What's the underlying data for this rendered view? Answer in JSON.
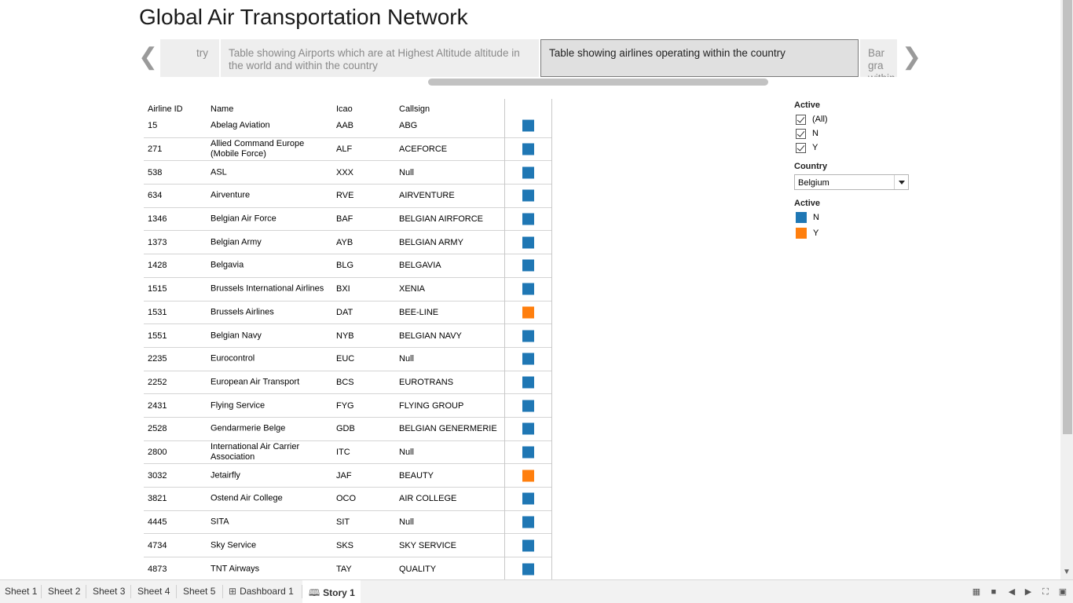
{
  "story": {
    "title": "Global Air Transportation Network"
  },
  "navigator": {
    "points": [
      "try",
      "Table showing Airports which are at Highest Altitude altitude in the world and within the country",
      "Table showing airlines operating within the country",
      "Bar gra within"
    ],
    "active_index": 2
  },
  "table": {
    "headers": [
      "Airline ID",
      "Name",
      "Icao",
      "Callsign"
    ],
    "rows": [
      {
        "id": "15",
        "name": "Abelag Aviation",
        "icao": "AAB",
        "callsign": "ABG",
        "active": "N"
      },
      {
        "id": "271",
        "name": "Allied Command Europe (Mobile Force)",
        "icao": "ALF",
        "callsign": "ACEFORCE",
        "active": "N"
      },
      {
        "id": "538",
        "name": "ASL",
        "icao": "XXX",
        "callsign": "Null",
        "active": "N"
      },
      {
        "id": "634",
        "name": "Airventure",
        "icao": "RVE",
        "callsign": "AIRVENTURE",
        "active": "N"
      },
      {
        "id": "1346",
        "name": "Belgian Air Force",
        "icao": "BAF",
        "callsign": "BELGIAN AIRFORCE",
        "active": "N"
      },
      {
        "id": "1373",
        "name": "Belgian Army",
        "icao": "AYB",
        "callsign": "BELGIAN ARMY",
        "active": "N"
      },
      {
        "id": "1428",
        "name": "Belgavia",
        "icao": "BLG",
        "callsign": "BELGAVIA",
        "active": "N"
      },
      {
        "id": "1515",
        "name": "Brussels International Airlines",
        "icao": "BXI",
        "callsign": "XENIA",
        "active": "N"
      },
      {
        "id": "1531",
        "name": "Brussels Airlines",
        "icao": "DAT",
        "callsign": "BEE-LINE",
        "active": "Y"
      },
      {
        "id": "1551",
        "name": "Belgian Navy",
        "icao": "NYB",
        "callsign": "BELGIAN NAVY",
        "active": "N"
      },
      {
        "id": "2235",
        "name": "Eurocontrol",
        "icao": "EUC",
        "callsign": "Null",
        "active": "N"
      },
      {
        "id": "2252",
        "name": "European Air Transport",
        "icao": "BCS",
        "callsign": "EUROTRANS",
        "active": "N"
      },
      {
        "id": "2431",
        "name": "Flying Service",
        "icao": "FYG",
        "callsign": "FLYING GROUP",
        "active": "N"
      },
      {
        "id": "2528",
        "name": "Gendarmerie Belge",
        "icao": "GDB",
        "callsign": "BELGIAN GENERMERIE",
        "active": "N"
      },
      {
        "id": "2800",
        "name": "International Air Carrier Association",
        "icao": "ITC",
        "callsign": "Null",
        "active": "N"
      },
      {
        "id": "3032",
        "name": "Jetairfly",
        "icao": "JAF",
        "callsign": "BEAUTY",
        "active": "Y"
      },
      {
        "id": "3821",
        "name": "Ostend Air College",
        "icao": "OCO",
        "callsign": "AIR COLLEGE",
        "active": "N"
      },
      {
        "id": "4445",
        "name": "SITA",
        "icao": "SIT",
        "callsign": "Null",
        "active": "N"
      },
      {
        "id": "4734",
        "name": "Sky Service",
        "icao": "SKS",
        "callsign": "SKY SERVICE",
        "active": "N"
      },
      {
        "id": "4873",
        "name": "TNT Airways",
        "icao": "TAY",
        "callsign": "QUALITY",
        "active": "N"
      }
    ]
  },
  "filters": {
    "active_label": "Active",
    "active_options": [
      {
        "label": "(All)",
        "checked": true
      },
      {
        "label": "N",
        "checked": true
      },
      {
        "label": "Y",
        "checked": true
      }
    ],
    "country_label": "Country",
    "country_value": "Belgium"
  },
  "legend": {
    "title": "Active",
    "items": [
      {
        "label": "N",
        "color": "#1f77b4"
      },
      {
        "label": "Y",
        "color": "#ff7f0e"
      }
    ]
  },
  "colors": {
    "N": "#1f77b4",
    "Y": "#ff7f0e"
  },
  "tabs": [
    {
      "label": "Sheet 1",
      "icon": "",
      "active": false
    },
    {
      "label": "Sheet 2",
      "icon": "",
      "active": false
    },
    {
      "label": "Sheet 3",
      "icon": "",
      "active": false
    },
    {
      "label": "Sheet 4",
      "icon": "",
      "active": false
    },
    {
      "label": "Sheet 5",
      "icon": "",
      "active": false
    },
    {
      "label": "Dashboard 1",
      "icon": "dashboard-icon",
      "active": false
    },
    {
      "label": "Story 1",
      "icon": "story-icon",
      "active": true
    }
  ]
}
